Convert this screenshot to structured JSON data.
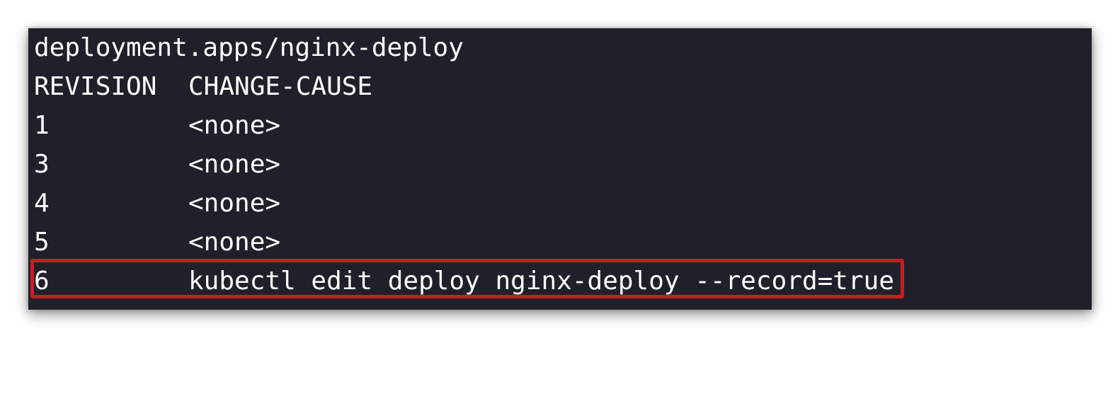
{
  "terminal": {
    "header": "deployment.apps/nginx-deploy",
    "columns": {
      "revision": "REVISION",
      "change_cause": "CHANGE-CAUSE"
    },
    "rows": [
      {
        "revision": "1",
        "change_cause": "<none>"
      },
      {
        "revision": "3",
        "change_cause": "<none>"
      },
      {
        "revision": "4",
        "change_cause": "<none>"
      },
      {
        "revision": "5",
        "change_cause": "<none>"
      },
      {
        "revision": "6",
        "change_cause": "kubectl edit deploy nginx-deploy --record=true"
      }
    ]
  },
  "colors": {
    "background": "#20202a",
    "text": "#ffffff",
    "highlight_border": "#cc1d24"
  }
}
